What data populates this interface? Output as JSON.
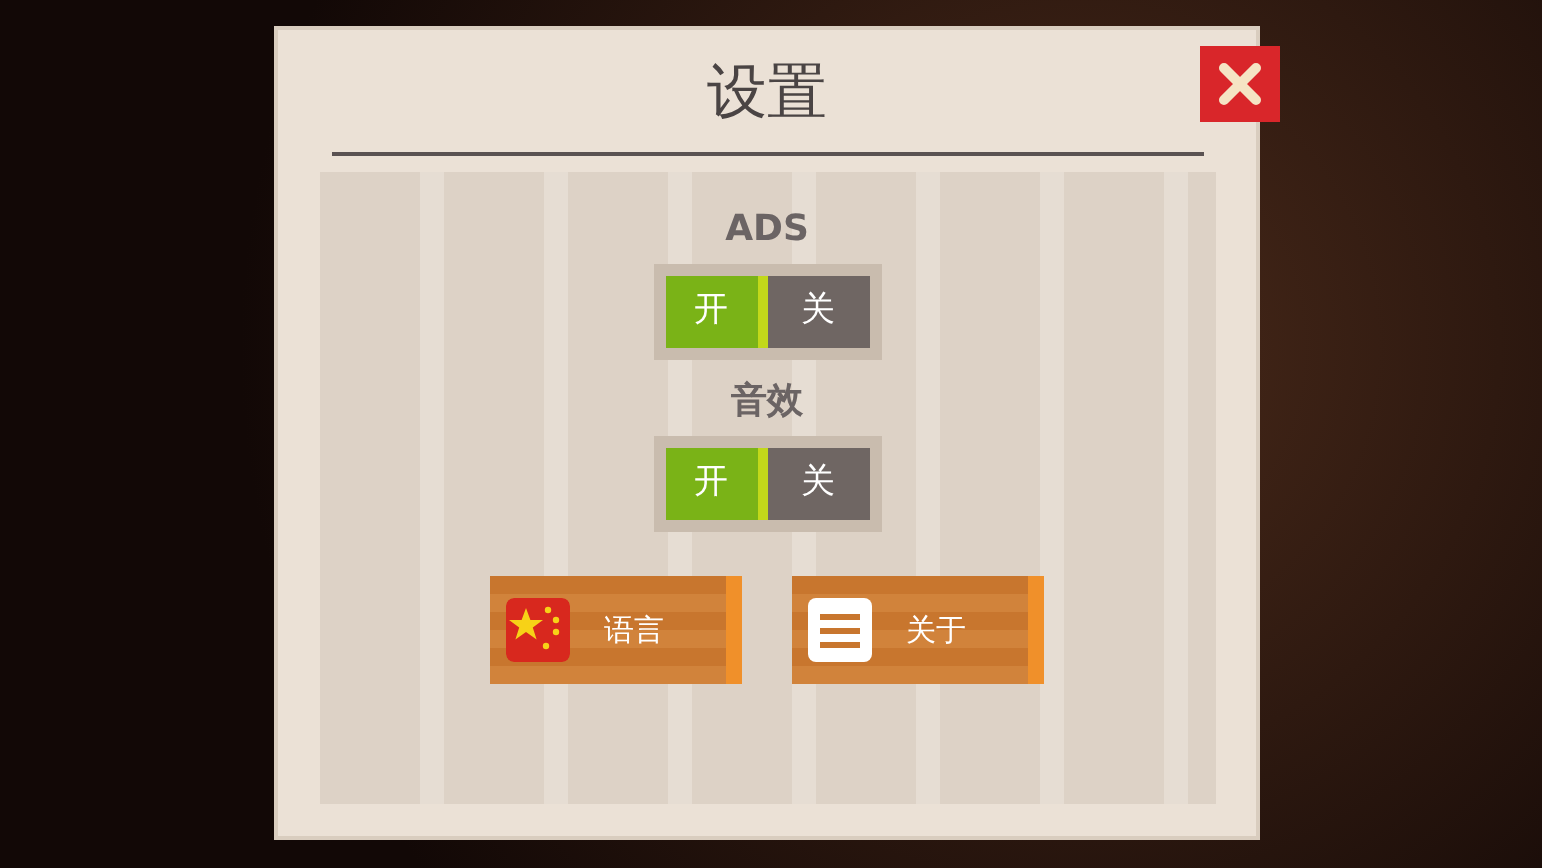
{
  "dialog": {
    "title": "设置"
  },
  "settings": [
    {
      "label": "ADS",
      "options": [
        {
          "label": "开",
          "selected": true
        },
        {
          "label": "关",
          "selected": false
        }
      ]
    },
    {
      "label": "音效",
      "options": [
        {
          "label": "开",
          "selected": true
        },
        {
          "label": "关",
          "selected": false
        }
      ]
    }
  ],
  "buttons": [
    {
      "kind": "flag",
      "label": "语言"
    },
    {
      "kind": "menu",
      "label": "关于"
    }
  ]
}
